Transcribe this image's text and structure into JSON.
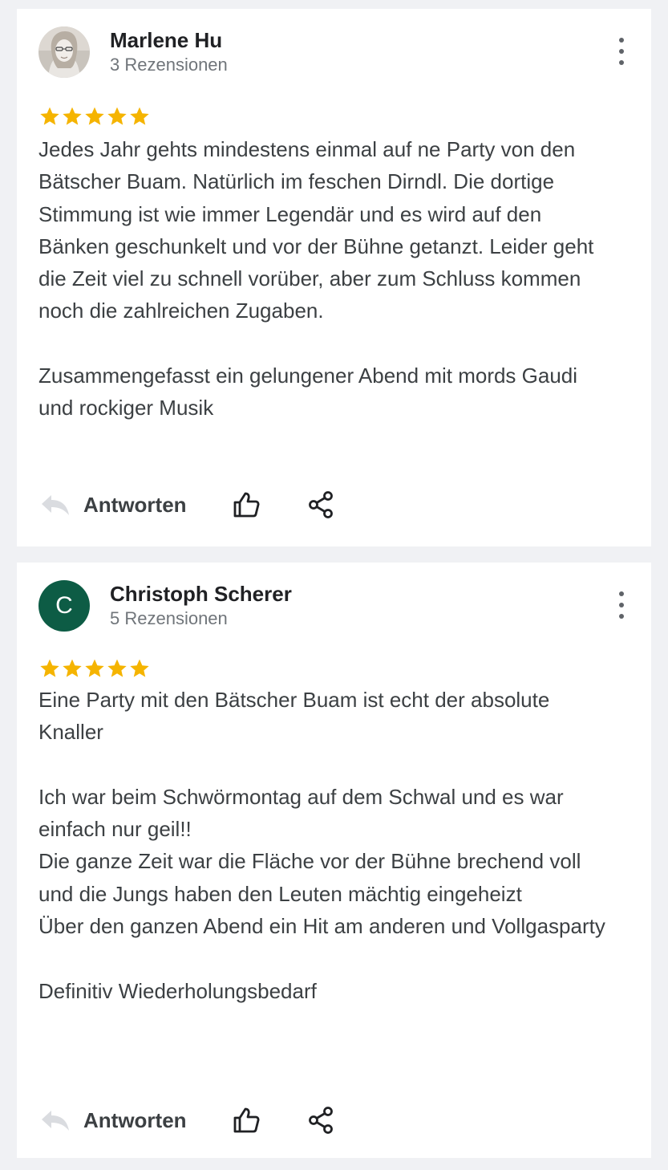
{
  "reviews": [
    {
      "author": "Marlene Hu",
      "review_count": "3 Rezensionen",
      "avatar_type": "photo",
      "rating": 5,
      "paragraphs": [
        "Jedes Jahr gehts mindestens einmal auf ne Party von den Bätscher Buam. Natürlich im feschen Dirndl. Die dortige Stimmung ist wie immer Legendär und es wird auf den Bänken geschunkelt und vor der Bühne getanzt. Leider geht die Zeit viel zu schnell vorüber, aber zum Schluss kommen noch die zahlreichen Zugaben.",
        "Zusammengefasst ein gelungener Abend mit mords Gaudi und rockiger Musik"
      ],
      "reply_label": "Antworten"
    },
    {
      "author": "Christoph Scherer",
      "review_count": "5 Rezensionen",
      "avatar_type": "letter",
      "avatar_letter": "C",
      "avatar_color": "#0d5c45",
      "rating": 5,
      "lines": [
        "Eine Party mit den Bätscher Buam ist echt der absolute Knaller",
        "",
        "Ich war beim Schwörmontag auf dem Schwal und es war einfach nur geil!!",
        "Die ganze Zeit war die Fläche vor der Bühne brechend voll und die Jungs haben den Leuten mächtig eingeheizt",
        "Über den ganzen Abend ein Hit am anderen und Vollgasparty",
        "",
        "Definitiv Wiederholungsbedarf"
      ],
      "reply_label": "Antworten"
    }
  ],
  "colors": {
    "star": "#f5b400",
    "background": "#f0f1f4",
    "card": "#ffffff"
  },
  "icons": [
    "reply-icon",
    "thumbs-up-icon",
    "share-icon",
    "more-vert-icon",
    "star-icon"
  ]
}
